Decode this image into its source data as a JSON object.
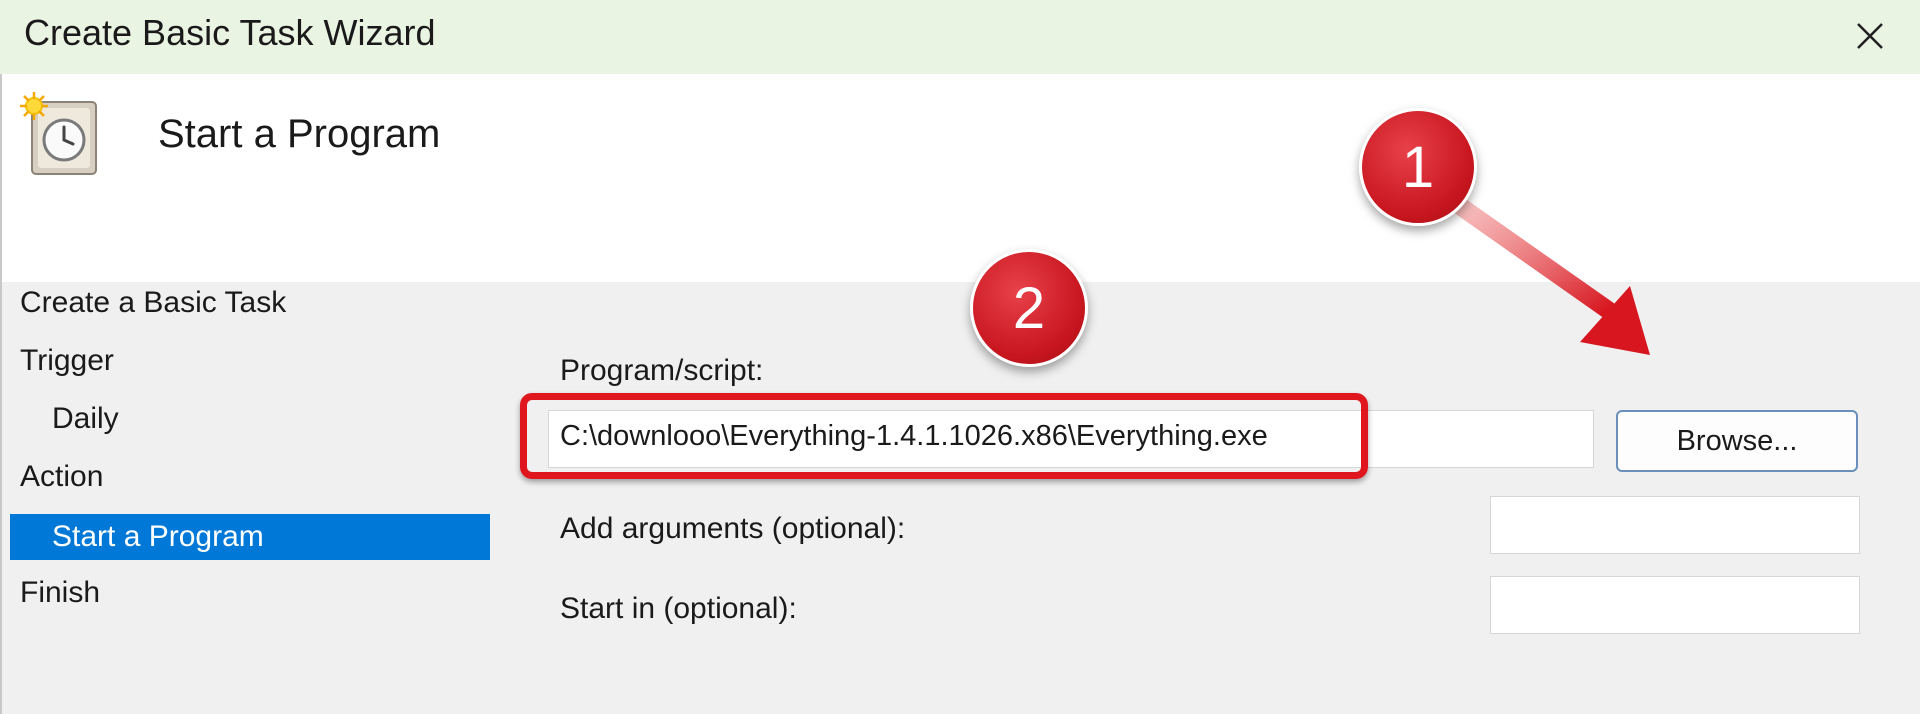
{
  "window": {
    "title": "Create Basic Task Wizard"
  },
  "header": {
    "title": "Start a Program"
  },
  "sidebar": {
    "items": [
      {
        "label": "Create a Basic Task"
      },
      {
        "label": "Trigger"
      },
      {
        "label": "Daily"
      },
      {
        "label": "Action"
      },
      {
        "label": "Start a Program",
        "selected": true
      },
      {
        "label": "Finish"
      }
    ]
  },
  "form": {
    "program_label": "Program/script:",
    "program_value": "C:\\downlooo\\Everything-1.4.1.1026.x86\\Everything.exe",
    "browse_label": "Browse...",
    "arguments_label": "Add arguments (optional):",
    "arguments_value": "",
    "start_in_label": "Start in (optional):",
    "start_in_value": ""
  },
  "annotations": {
    "badge_1": "1",
    "badge_2": "2",
    "color": "#d0161f"
  },
  "icons": {
    "close": "close-icon",
    "app": "task-scheduler-clock-icon"
  }
}
